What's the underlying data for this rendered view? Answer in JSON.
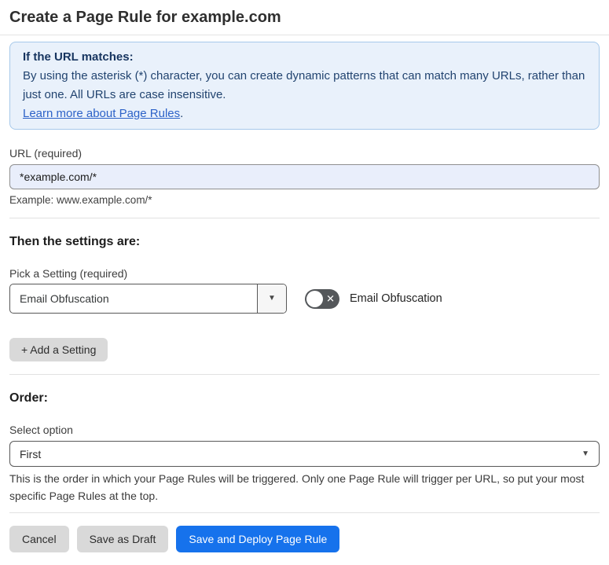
{
  "header": {
    "title": "Create a Page Rule for example.com"
  },
  "info_box": {
    "heading": "If the URL matches:",
    "body": "By using the asterisk (*) character, you can create dynamic patterns that can match many URLs, rather than just one. All URLs are case insensitive.",
    "link_label": "Learn more about Page Rules",
    "link_suffix": "."
  },
  "url_field": {
    "label": "URL (required)",
    "value": "*example.com/*",
    "example": "Example: www.example.com/*"
  },
  "settings": {
    "heading": "Then the settings are:",
    "pick_label": "Pick a Setting (required)",
    "selected_setting": "Email Obfuscation",
    "toggle_label": "Email Obfuscation",
    "toggle_state": "off",
    "toggle_off_glyph": "✕",
    "add_button_label": "+ Add a Setting"
  },
  "order": {
    "heading": "Order:",
    "select_label": "Select option",
    "selected_option": "First",
    "description": "This is the order in which your Page Rules will be triggered. Only one Page Rule will trigger per URL, so put your most specific Page Rules at the top."
  },
  "footer": {
    "cancel_label": "Cancel",
    "save_draft_label": "Save as Draft",
    "save_deploy_label": "Save and Deploy Page Rule"
  },
  "icons": {
    "dropdown_arrow": "▼"
  },
  "colors": {
    "accent_blue": "#1672ec",
    "info_bg": "#e9f1fb",
    "info_border": "#a6c8ea",
    "info_text": "#1e3c64",
    "link_blue": "#2c62c8",
    "input_bg": "#e9eefb",
    "toggle_off_bg": "#54575a",
    "gray_button_bg": "#d9d9d9"
  }
}
